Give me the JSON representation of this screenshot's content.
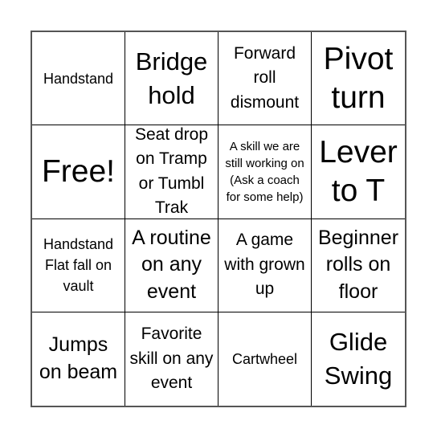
{
  "board": {
    "rows": 4,
    "cols": 4,
    "border_color": "#555555",
    "line_color": "#000000",
    "cells": [
      {
        "text": "Handstand",
        "size": "s-sm"
      },
      {
        "text": "Bridge hold",
        "size": "s-xl"
      },
      {
        "text": "Forward roll dismount",
        "size": "s-md"
      },
      {
        "text": "Pivot turn",
        "size": "s-xxl"
      },
      {
        "text": "Free!",
        "size": "s-xxl"
      },
      {
        "text": "Seat drop on Tramp or Tumbl Trak",
        "size": "s-md"
      },
      {
        "text": "A skill we are still working on (Ask a coach for some help)",
        "size": "s-xs"
      },
      {
        "text": "Lever to T",
        "size": "s-xxl"
      },
      {
        "text": "Handstand Flat fall on vault",
        "size": "s-sm"
      },
      {
        "text": "A routine on any event",
        "size": "s-lg"
      },
      {
        "text": "A game with grown up",
        "size": "s-md"
      },
      {
        "text": "Beginner rolls on floor",
        "size": "s-lg"
      },
      {
        "text": "Jumps on beam",
        "size": "s-lg"
      },
      {
        "text": "Favorite skill on any event",
        "size": "s-md"
      },
      {
        "text": "Cartwheel",
        "size": "s-sm"
      },
      {
        "text": "Glide Swing",
        "size": "s-xl"
      }
    ]
  }
}
